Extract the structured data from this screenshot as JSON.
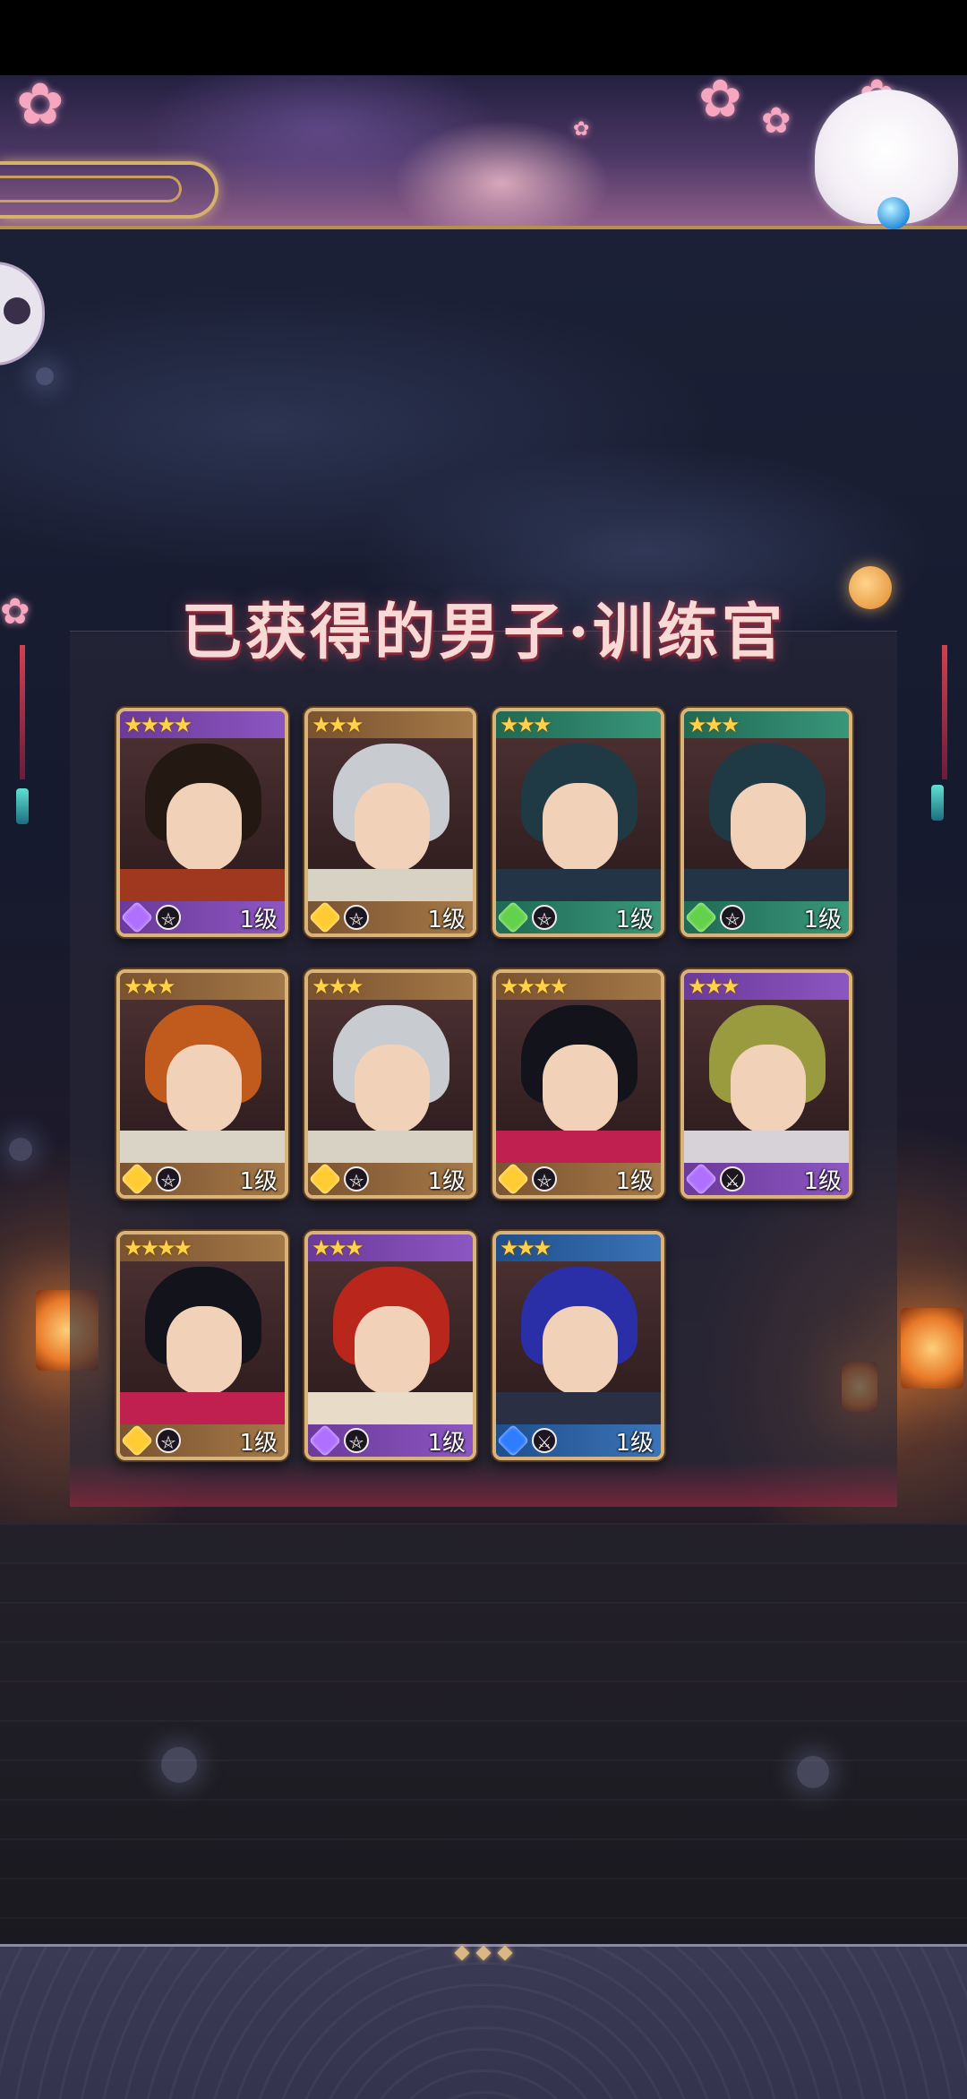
{
  "screen": {
    "title": "已获得的男子·训练官"
  },
  "colors": {
    "card_border": "#d8b47a",
    "title_text": "#f7d9d6",
    "level_text": "#ffffff",
    "star": "#ffd24a"
  },
  "cards": [
    {
      "stars": "★★★★",
      "level": "1级",
      "rarity": "purple",
      "element": "purple-gem",
      "type": "pentagram-icon",
      "hair": "#241813",
      "collar": "#a0381f"
    },
    {
      "stars": "★★★",
      "level": "1级",
      "rarity": "bronze",
      "element": "yellow-gem",
      "type": "pentagram-icon",
      "hair": "#c8cbd0",
      "collar": "#d8d2c4"
    },
    {
      "stars": "★★★",
      "level": "1级",
      "rarity": "green",
      "element": "green-leaf",
      "type": "pentagram-icon",
      "hair": "#1f3a44",
      "collar": "#233447"
    },
    {
      "stars": "★★★",
      "level": "1级",
      "rarity": "green",
      "element": "green-leaf",
      "type": "pentagram-icon",
      "hair": "#1f3a44",
      "collar": "#233447"
    },
    {
      "stars": "★★★",
      "level": "1级",
      "rarity": "bronze",
      "element": "yellow-gem",
      "type": "pentagram-icon",
      "hair": "#c15a1d",
      "collar": "#d9d4c6"
    },
    {
      "stars": "★★★",
      "level": "1级",
      "rarity": "bronze",
      "element": "yellow-gem",
      "type": "pentagram-icon",
      "hair": "#c8cbd0",
      "collar": "#d8d2c4"
    },
    {
      "stars": "★★★★",
      "level": "1级",
      "rarity": "bronze",
      "element": "yellow-gem",
      "type": "pentagram-icon",
      "hair": "#13131c",
      "collar": "#c02050"
    },
    {
      "stars": "★★★",
      "level": "1级",
      "rarity": "purple",
      "element": "purple-gem",
      "type": "crossed-swords-icon",
      "hair": "#9a9a3e",
      "collar": "#d6d2d8"
    },
    {
      "stars": "★★★★",
      "level": "1级",
      "rarity": "bronze",
      "element": "yellow-gem",
      "type": "pentagram-icon",
      "hair": "#13131c",
      "collar": "#c02050"
    },
    {
      "stars": "★★★",
      "level": "1级",
      "rarity": "purple",
      "element": "purple-gem",
      "type": "pentagram-icon",
      "hair": "#b8261c",
      "collar": "#e8dcc9"
    },
    {
      "stars": "★★★",
      "level": "1级",
      "rarity": "blue",
      "element": "blue-drop",
      "type": "crossed-swords-icon",
      "hair": "#2a2fa8",
      "collar": "#2b2f44"
    }
  ]
}
